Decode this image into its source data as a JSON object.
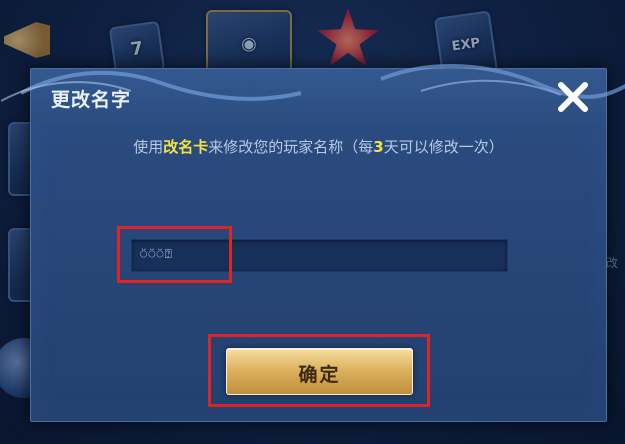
{
  "dialog": {
    "title": "更改名字",
    "subtitle": {
      "prefix": "使用",
      "item_name": "改名卡",
      "middle": "来修改您的玩家名称（每",
      "days": "3",
      "suffix": "天可以修改一次）"
    },
    "name_input": {
      "value": "⍥⍥⍥⍰"
    },
    "confirm_label": "确定",
    "close_icon": "close-x-icon"
  },
  "background_items": [
    {
      "icon": "horn-icon"
    },
    {
      "icon": "ticket-icon",
      "glyph": "7"
    },
    {
      "icon": "badge-icon"
    },
    {
      "icon": "red-flower-icon"
    },
    {
      "icon": "exp-card-icon",
      "glyph": "EXP"
    },
    {
      "icon": "item-card-icon"
    },
    {
      "icon": "item-card-icon"
    },
    {
      "icon": "orb-icon"
    }
  ],
  "colors": {
    "highlight_text": "#f1e240",
    "confirm_gold": "#dcb25f",
    "annotation_red": "#e02424",
    "dialog_blue": "#28477a"
  }
}
